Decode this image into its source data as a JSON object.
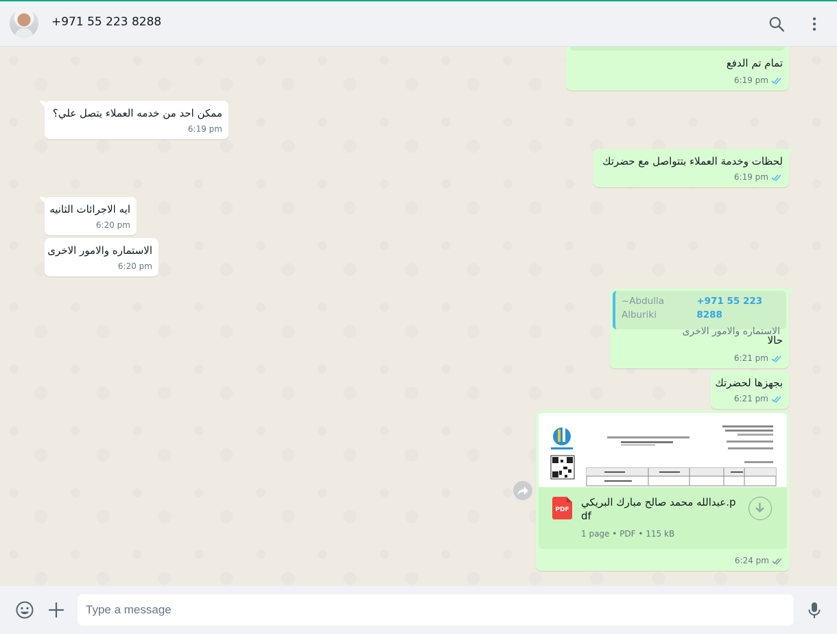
{
  "header": {
    "contact_name": "+971 55 223 8288",
    "icons": [
      "search-icon",
      "menu-icon"
    ]
  },
  "messages": [
    {
      "dir": "out",
      "text": "تمام تم الدفع",
      "time": "6:19 pm",
      "status": "read"
    },
    {
      "dir": "in",
      "text": "ممكن احد من خدمه العملاء يتصل علي؟",
      "time": "6:19 pm"
    },
    {
      "dir": "out",
      "text": "لحظات وخدمة العملاء بتتواصل مع حضرتك",
      "time": "6:19 pm",
      "status": "read"
    },
    {
      "dir": "in",
      "text": "ايه الاجرائات الثانيه",
      "time": "6:20 pm"
    },
    {
      "dir": "in",
      "text": "الاستماره والامور الاخرى",
      "time": "6:20 pm"
    },
    {
      "dir": "out",
      "text": "حالا",
      "time": "6:21 pm",
      "status": "read",
      "quote": {
        "phone": "+971 55 223 8288",
        "author": "~Abdulla Alburiki",
        "text": "الاستماره والامور الاخرى"
      }
    },
    {
      "dir": "out",
      "text": "بجهزها لحضرتك",
      "time": "6:21 pm",
      "status": "read"
    },
    {
      "dir": "out",
      "type": "document",
      "time": "6:24 pm",
      "status": "read",
      "document": {
        "filename": "عبدالله محمد صالح مبارك البريكي.pdf",
        "icon_label": "PDF",
        "pages": "1 page",
        "type": "PDF",
        "size": "115 kB"
      }
    }
  ],
  "composer": {
    "placeholder": "Type a message",
    "icons": [
      "emoji-icon",
      "attach-icon",
      "mic-icon"
    ]
  },
  "colors": {
    "accent": "#00a884",
    "outgoing_bubble": "#d9fdd3",
    "incoming_bubble": "#ffffff",
    "read_ticks": "#53bdeb",
    "quote_author": "#35a4e5",
    "chat_background": "#efeae2"
  }
}
